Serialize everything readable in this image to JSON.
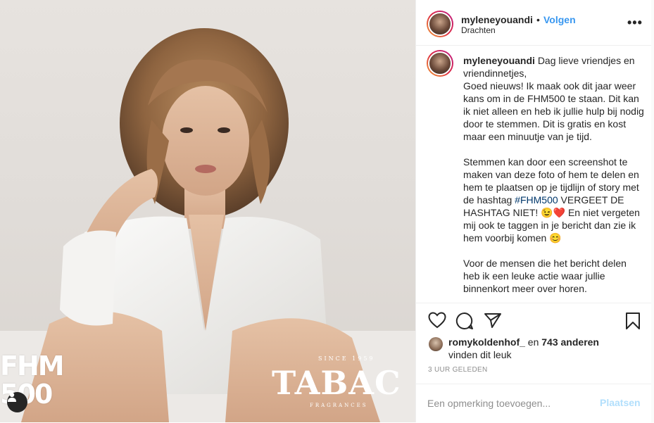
{
  "post": {
    "image": {
      "overlay_logo_fhm": [
        "FHM",
        "500"
      ],
      "overlay_brand": {
        "since": "SINCE 1959",
        "name": "TABAC",
        "subtitle": "FRAGRANCES"
      }
    },
    "header": {
      "username": "myleneyouandi",
      "separator": "•",
      "follow_label": "Volgen",
      "location": "Drachten",
      "more_label": "•••"
    },
    "caption": {
      "username": "myleneyouandi",
      "text_part1": "Dag lieve vriendjes en vriendinnetjes,\nGoed nieuws! Ik maak ook dit jaar weer kans om in de FHM500 te staan. Dit kan ik niet alleen en heb ik jullie hulp bij nodig door te stemmen. Dit is gratis en kost maar een minuutje van je tijd.\n\nStemmen kan door een screenshot te maken van deze foto of hem te delen en hem te plaatsen op je tijdlijn of story met de hashtag ",
      "hashtag": "#FHM500",
      "text_part2": " VERGEET DE HASHTAG NIET! 😉❤️ En niet vergeten mij ook te taggen in je bericht dan zie ik hem voorbij komen 😊\n\nVoor de mensen die het bericht delen heb ik een leuke actie waar jullie binnenkort meer over horen."
    },
    "likes": {
      "first_user": "romykoldenhof_",
      "connector": " en ",
      "others": "743 anderen",
      "suffix": "vinden dit leuk"
    },
    "timestamp": "3 UUR GELEDEN",
    "comment": {
      "placeholder": "Een opmerking toevoegen...",
      "post_label": "Plaatsen"
    }
  },
  "colors": {
    "accent": "#3897f0",
    "hashtag": "#00376b",
    "post_disabled": "#b2dffc",
    "muted": "#8e8e8e",
    "text": "#262626"
  }
}
